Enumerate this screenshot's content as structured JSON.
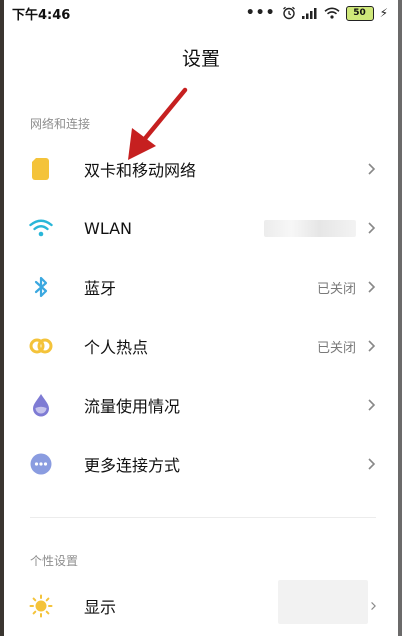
{
  "status_bar": {
    "time": "下午4:46",
    "battery": "50"
  },
  "page_title": "设置",
  "sections": [
    {
      "label": "网络和连接"
    },
    {
      "label": "个性设置"
    }
  ],
  "items": [
    {
      "label": "双卡和移动网络",
      "value": "",
      "icon": "sim-card-icon",
      "color": "#F4C33A"
    },
    {
      "label": "WLAN",
      "value": "",
      "icon": "wifi-icon",
      "color": "#29B6D8"
    },
    {
      "label": "蓝牙",
      "value": "已关闭",
      "icon": "bluetooth-icon",
      "color": "#3BA8E0"
    },
    {
      "label": "个人热点",
      "value": "已关闭",
      "icon": "hotspot-icon",
      "color": "#F4C33A"
    },
    {
      "label": "流量使用情况",
      "value": "",
      "icon": "data-usage-icon",
      "color": "#7E7BD4"
    },
    {
      "label": "更多连接方式",
      "value": "",
      "icon": "more-connections-icon",
      "color": "#8A9CE0"
    },
    {
      "label": "显示",
      "value": "",
      "icon": "display-icon",
      "color": "#F4C33A"
    }
  ]
}
